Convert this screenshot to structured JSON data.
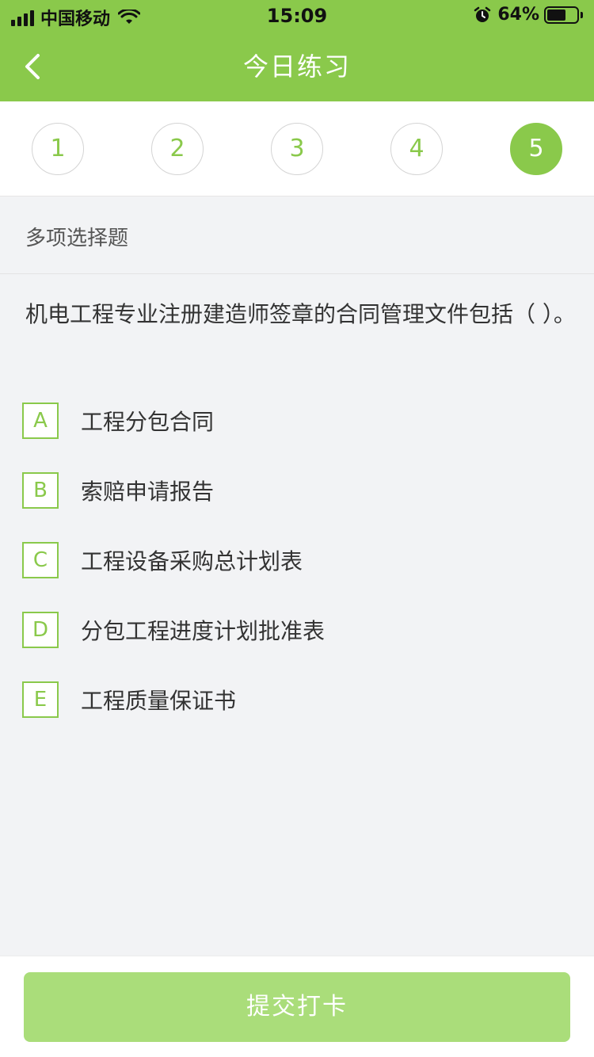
{
  "status_bar": {
    "carrier": "中国移动",
    "time": "15:09",
    "battery_percent": "64%",
    "battery_level": 0.64,
    "icons": [
      "signal-icon",
      "wifi-icon",
      "alarm-icon",
      "battery-icon"
    ]
  },
  "nav": {
    "title": "今日练习",
    "back_icon": "chevron-left-icon"
  },
  "question_numbers": [
    {
      "label": "1",
      "active": false
    },
    {
      "label": "2",
      "active": false
    },
    {
      "label": "3",
      "active": false
    },
    {
      "label": "4",
      "active": false
    },
    {
      "label": "5",
      "active": true
    }
  ],
  "question": {
    "type": "多项选择题",
    "stem": "机电工程专业注册建造师签章的合同管理文件包括（ ）。",
    "options": [
      {
        "key": "A",
        "text": "工程分包合同"
      },
      {
        "key": "B",
        "text": "索赔申请报告"
      },
      {
        "key": "C",
        "text": "工程设备采购总计划表"
      },
      {
        "key": "D",
        "text": "分包工程进度计划批准表"
      },
      {
        "key": "E",
        "text": "工程质量保证书"
      }
    ]
  },
  "submit": {
    "label": "提交打卡"
  },
  "colors": {
    "brand_green": "#8ac94b",
    "submit_disabled": "#aadd7a",
    "background": "#f2f3f5"
  }
}
